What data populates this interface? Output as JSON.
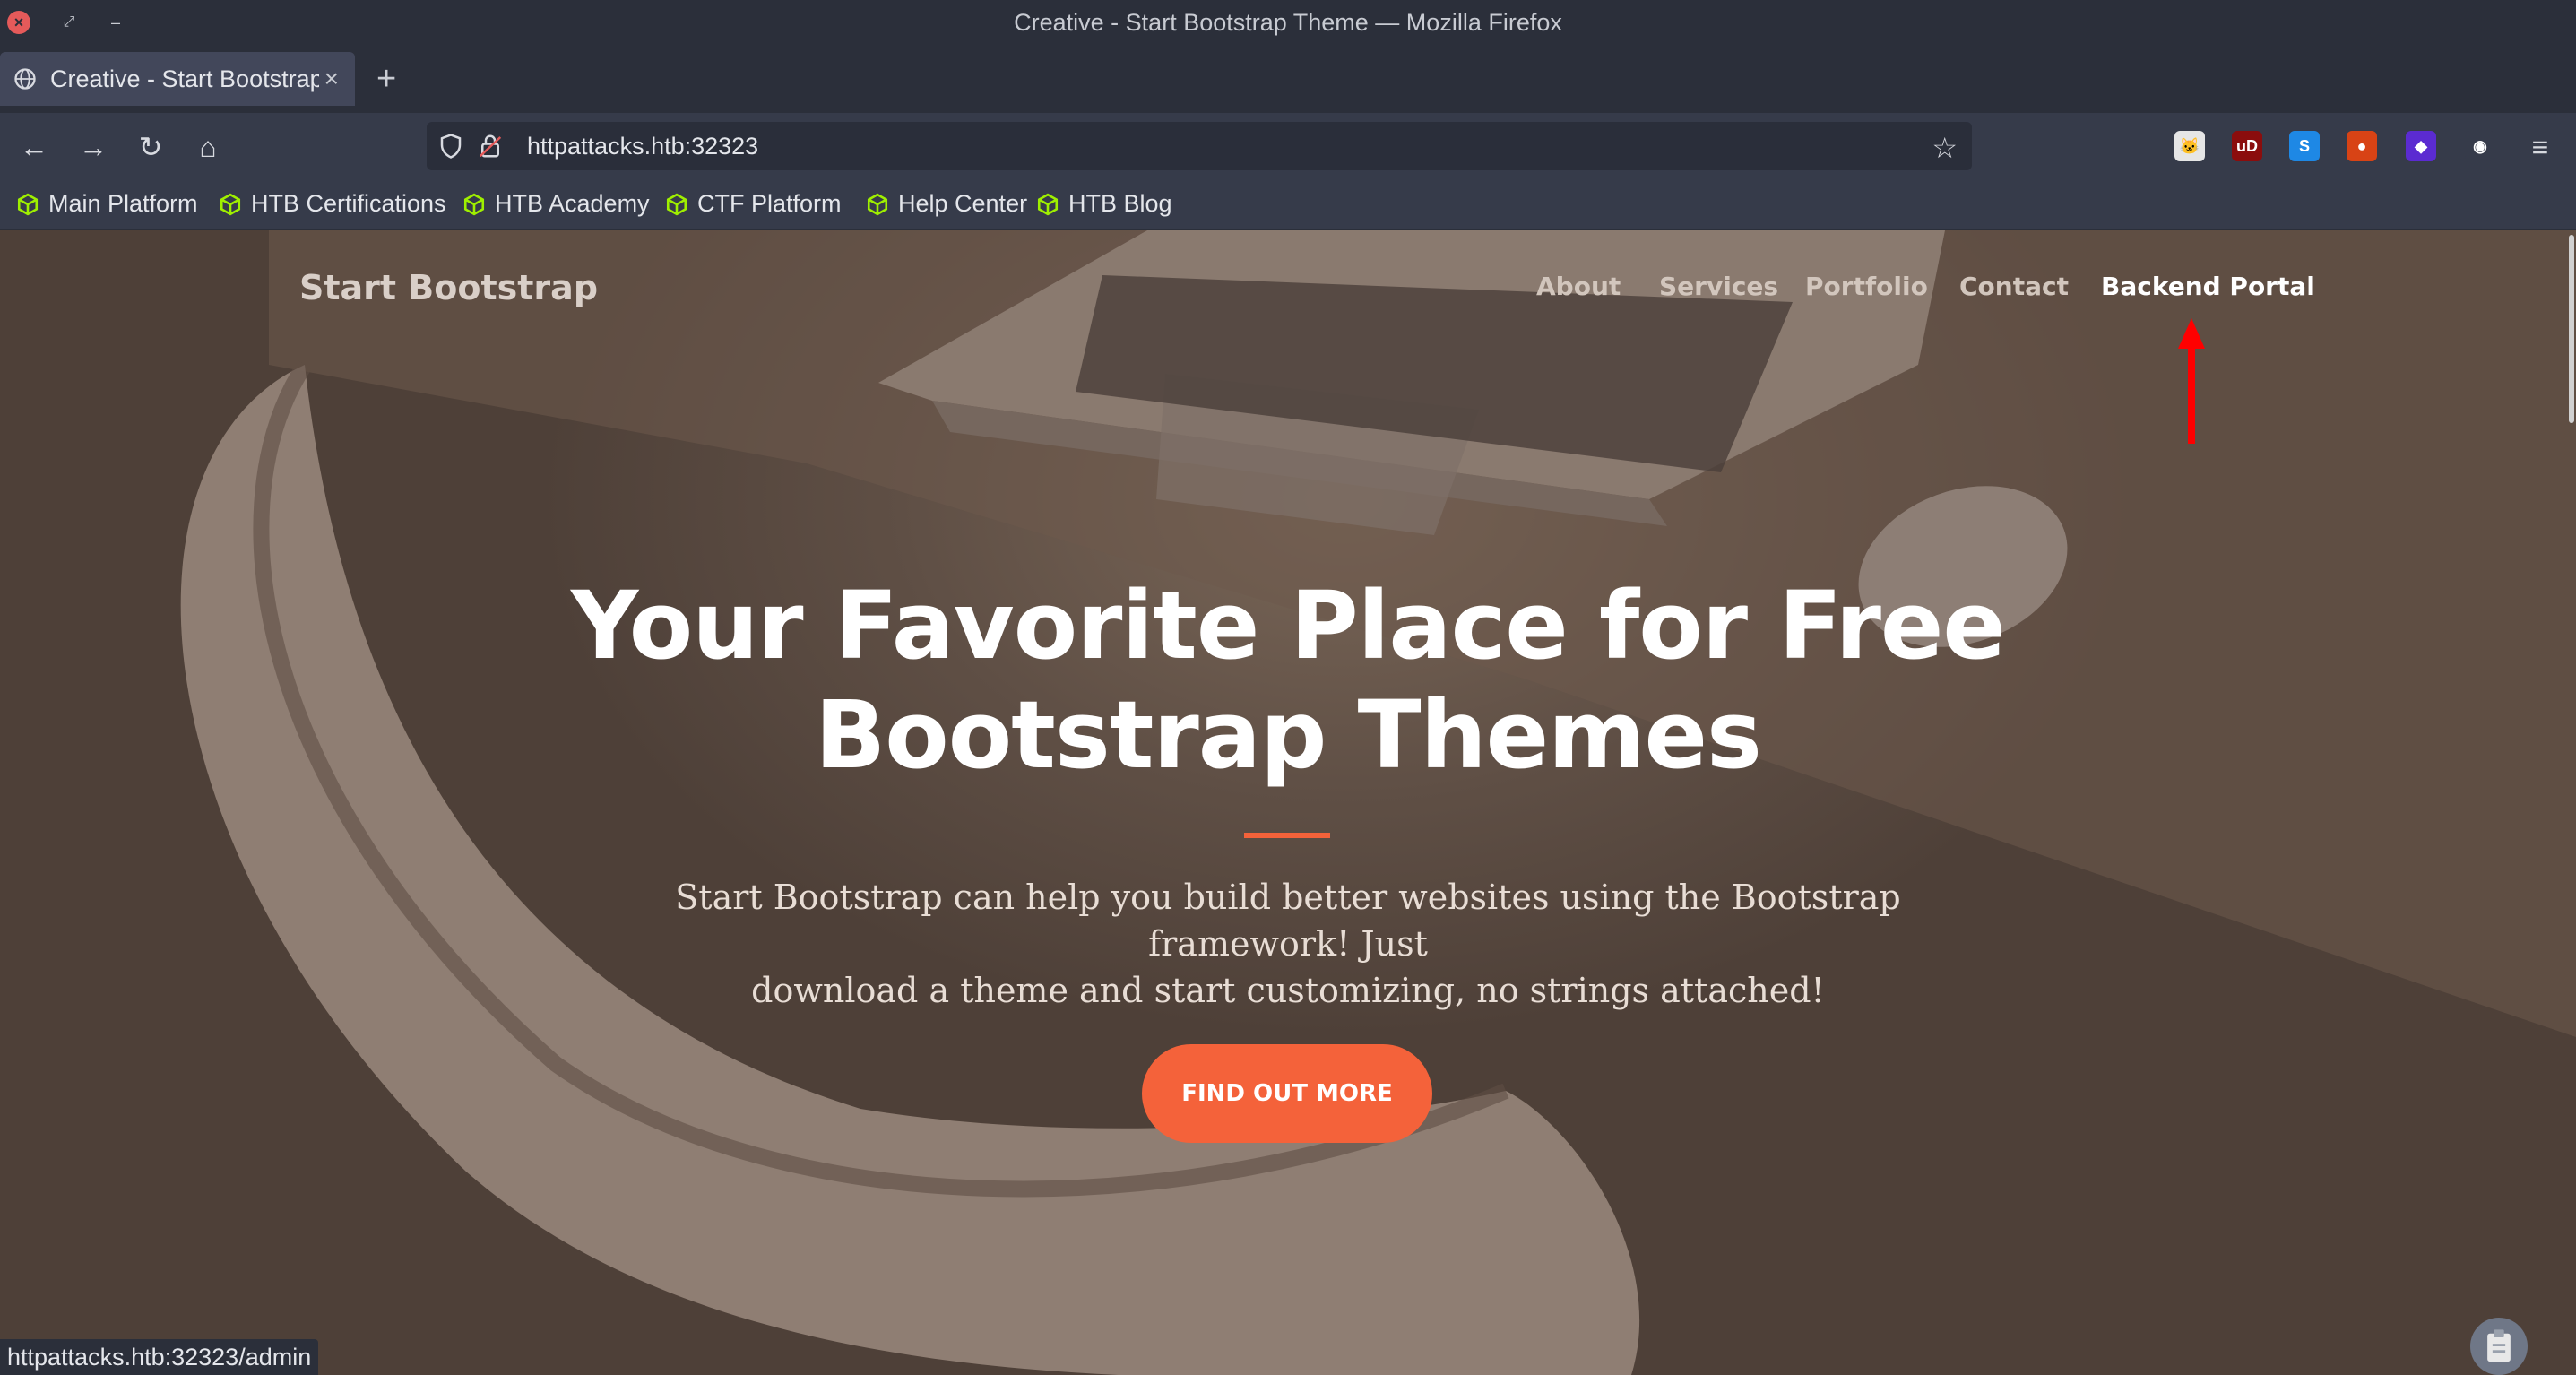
{
  "window": {
    "title": "Creative - Start Bootstrap Theme — Mozilla Firefox",
    "close_glyph": "×",
    "restore_glyph": "⤢",
    "minimize_glyph": "–"
  },
  "tab": {
    "label": "Creative - Start Bootstrap Theme",
    "close_glyph": "×",
    "new_tab_glyph": "+"
  },
  "toolbar": {
    "back_glyph": "←",
    "forward_glyph": "→",
    "reload_glyph": "↻",
    "home_glyph": "⌂",
    "url": "httpattacks.htb:32323",
    "star_glyph": "☆",
    "menu_glyph": "≡",
    "extensions": [
      {
        "name": "hacker-cat-extension-icon",
        "color": "#e6e6e6",
        "glyph": "🐱"
      },
      {
        "name": "ublock-origin-icon",
        "color": "#8b0d0d",
        "glyph": "uD"
      },
      {
        "name": "s-extension-icon",
        "color": "#1e88e5",
        "glyph": "S"
      },
      {
        "name": "foxy-proxy-icon",
        "color": "#d84315",
        "glyph": "●"
      },
      {
        "name": "wappalyzer-icon",
        "color": "#5b2bd1",
        "glyph": "◆"
      },
      {
        "name": "cookie-editor-icon",
        "color": "#363b4a",
        "glyph": "◉"
      }
    ]
  },
  "bookmarks": [
    {
      "label": "Main Platform"
    },
    {
      "label": "HTB Certifications"
    },
    {
      "label": "HTB Academy"
    },
    {
      "label": "CTF Platform"
    },
    {
      "label": "Help Center"
    },
    {
      "label": "HTB Blog"
    }
  ],
  "site": {
    "brand": "Start Bootstrap",
    "nav": [
      "About",
      "Services",
      "Portfolio",
      "Contact",
      "Backend Portal"
    ],
    "hero_title_line1": "Your Favorite Place for Free",
    "hero_title_line2": "Bootstrap Themes",
    "hero_sub_line1": "Start Bootstrap can help you build better websites using the Bootstrap framework! Just",
    "hero_sub_line2": "download a theme and start customizing, no strings attached!",
    "cta": "FIND OUT MORE"
  },
  "status": {
    "link_preview": "httpattacks.htb:32323/admin"
  },
  "colors": {
    "accent": "#f4623a",
    "annotation_arrow": "#ff0000",
    "bookmark_icon": "#9fef00"
  }
}
